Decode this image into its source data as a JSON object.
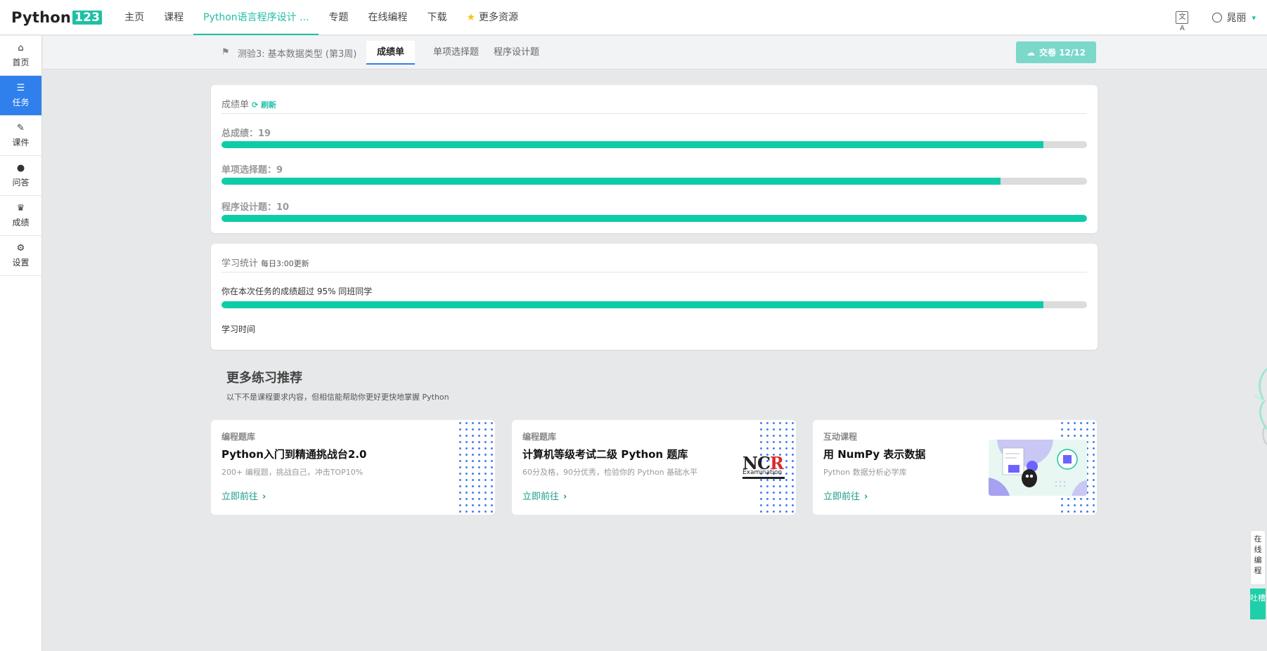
{
  "topnav": {
    "logo_text": "Python",
    "logo_num": "123",
    "links": [
      "主页",
      "课程",
      "Python语言程序设计 ...",
      "专题",
      "在线编程",
      "下载",
      "更多资源"
    ],
    "user_name": "晁丽"
  },
  "sidebar": {
    "items": [
      {
        "label": "首页",
        "icon": "home-icon"
      },
      {
        "label": "任务",
        "icon": "list-icon"
      },
      {
        "label": "课件",
        "icon": "paperclip-icon"
      },
      {
        "label": "问答",
        "icon": "comments-icon"
      },
      {
        "label": "成绩",
        "icon": "trophy-icon"
      },
      {
        "label": "设置",
        "icon": "gear-icon"
      }
    ]
  },
  "tabs": {
    "quiz_label": "测验3: 基本数据类型 (第3周)",
    "items": [
      "成绩单",
      "单项选择题",
      "程序设计题"
    ],
    "submit_label": "交卷 12/12"
  },
  "scores": {
    "title": "成绩单",
    "refresh": "刷新",
    "rows": [
      {
        "label": "总成绩：19",
        "fraction": 0.95
      },
      {
        "label": "单项选择题：9",
        "fraction": 0.9
      },
      {
        "label": "程序设计题：10",
        "fraction": 1.0
      }
    ]
  },
  "stats": {
    "title": "学习统计",
    "subtitle": "每日3:00更新",
    "exceed_text": "你在本次任务的成绩超过 95% 同班同学",
    "exceed_fraction": 0.95,
    "time_label": "学习时间"
  },
  "more": {
    "title": "更多练习推荐",
    "subtitle": "以下不是课程要求内容，但相信能帮助你更好更快地掌握 Python",
    "cards": [
      {
        "category": "编程题库",
        "title": "Python入门到精通挑战台2.0",
        "desc": "200+ 编程题，挑战自己，冲击TOP10%",
        "go": "立即前往"
      },
      {
        "category": "编程题库",
        "title": "计算机等级考试二级 Python 题库",
        "desc": "60分及格，90分优秀，检验你的 Python 基础水平",
        "go": "立即前往",
        "logo_text": "NCR",
        "logo_sub": "Examination"
      },
      {
        "category": "互动课程",
        "title": "用 NumPy 表示数据",
        "desc": "Python 数据分析必学库",
        "go": "立即前往"
      }
    ]
  },
  "floating": {
    "online": "在线编程",
    "feedback": "吐槽"
  },
  "colors": {
    "accent": "#1fbfa6",
    "progress": "#0fcca8",
    "sidebar_active": "#2f80ed"
  }
}
